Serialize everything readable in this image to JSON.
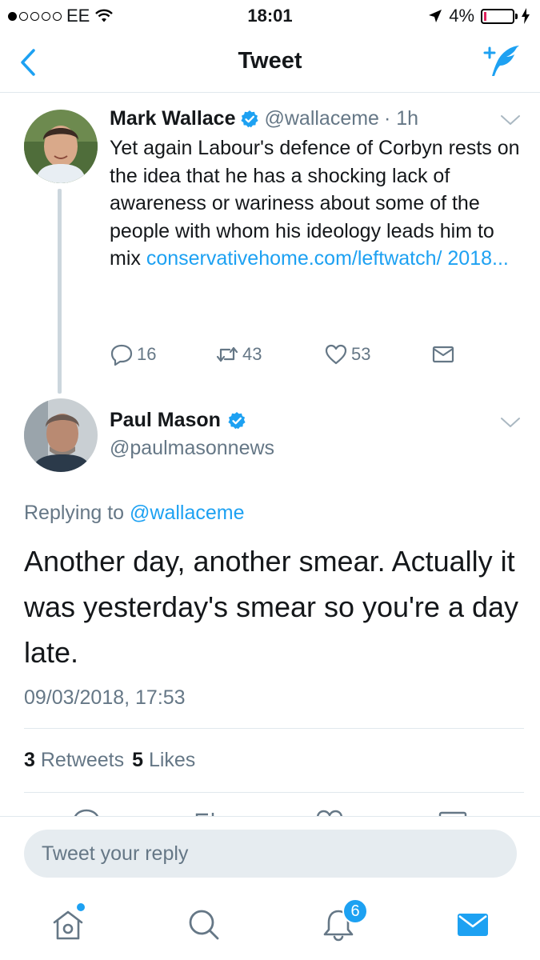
{
  "status_bar": {
    "carrier": "EE",
    "time": "18:01",
    "battery": "4%"
  },
  "nav": {
    "title": "Tweet"
  },
  "parent_tweet": {
    "name": "Mark Wallace",
    "handle": "@wallaceme",
    "age": "· 1h",
    "text": "Yet again Labour's defence of Corbyn rests on the idea that he has a shocking lack of awareness or wariness about some of the people with whom his ideology leads him to mix",
    "link": "conservativehome.com/leftwatch/ 2018...",
    "replies": "16",
    "retweets": "43",
    "likes": "53"
  },
  "main_tweet": {
    "name": "Paul Mason",
    "handle": "@paulmasonnews",
    "replying_prefix": "Replying to",
    "replying_handle": "@wallaceme",
    "text": "Another day, another smear. Actually it was yesterday's smear so you're a day late.",
    "timestamp": "09/03/2018, 17:53",
    "retweet_count": "3",
    "retweet_label": "Retweets",
    "like_count": "5",
    "like_label": "Likes"
  },
  "reply": {
    "placeholder": "Tweet your reply"
  },
  "tabbar": {
    "notifications_badge": "6"
  },
  "colors": {
    "accent": "#1da1f2",
    "secondary_text": "#657786",
    "divider": "#e1e8ed"
  }
}
